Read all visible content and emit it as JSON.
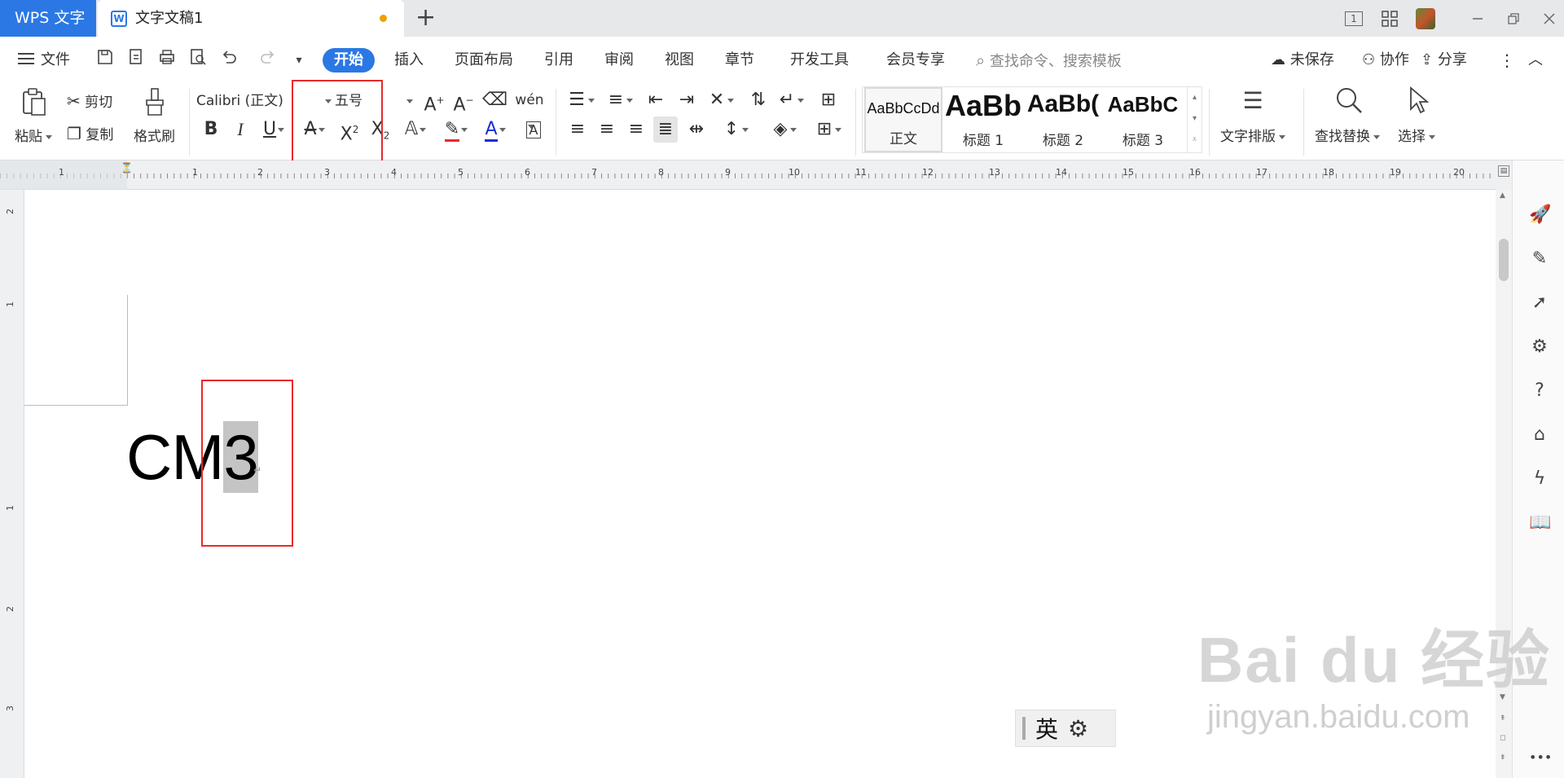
{
  "app": {
    "name": "WPS 文字"
  },
  "document": {
    "name": "文字文稿1",
    "body_text_plain": "CM",
    "body_text_selected": "3"
  },
  "titlebar": {
    "page_indicator": "1"
  },
  "menu": {
    "file": "文件",
    "tabs": [
      "开始",
      "插入",
      "页面布局",
      "引用",
      "审阅",
      "视图",
      "章节",
      "开发工具",
      "会员专享"
    ],
    "active_tab": "开始",
    "search_placeholder": "查找命令、搜索模板",
    "unsaved": "未保存",
    "collab": "协作",
    "share": "分享"
  },
  "ribbon": {
    "paste": "粘贴",
    "cut": "剪切",
    "copy": "复制",
    "format_painter": "格式刷",
    "font_name": "Calibri (正文)",
    "font_size": "五号",
    "phonetic": "wén",
    "styles": [
      {
        "sample": "AaBbCcDd",
        "name": "正文"
      },
      {
        "sample": "AaBb",
        "name": "标题 1"
      },
      {
        "sample": "AaBb(",
        "name": "标题 2"
      },
      {
        "sample": "AaBbC",
        "name": "标题 3"
      }
    ],
    "text_layout": "文字排版",
    "find_replace": "查找替换",
    "select": "选择"
  },
  "ruler": {
    "numbers": [
      "1",
      "1",
      "2",
      "3",
      "4",
      "5",
      "6",
      "7",
      "8",
      "9",
      "10",
      "11",
      "12",
      "13",
      "14",
      "15",
      "16",
      "17",
      "18",
      "19",
      "20"
    ],
    "vertical_numbers": [
      "2",
      "1",
      "1",
      "2",
      "3"
    ]
  },
  "ime": {
    "lang": "英"
  },
  "watermark": {
    "main": "Bai du 经验",
    "sub": "jingyan.baidu.com"
  },
  "colors": {
    "accent": "#2b78e4",
    "highlight_red": "#e8292b",
    "selection": "#c4c4c4"
  }
}
